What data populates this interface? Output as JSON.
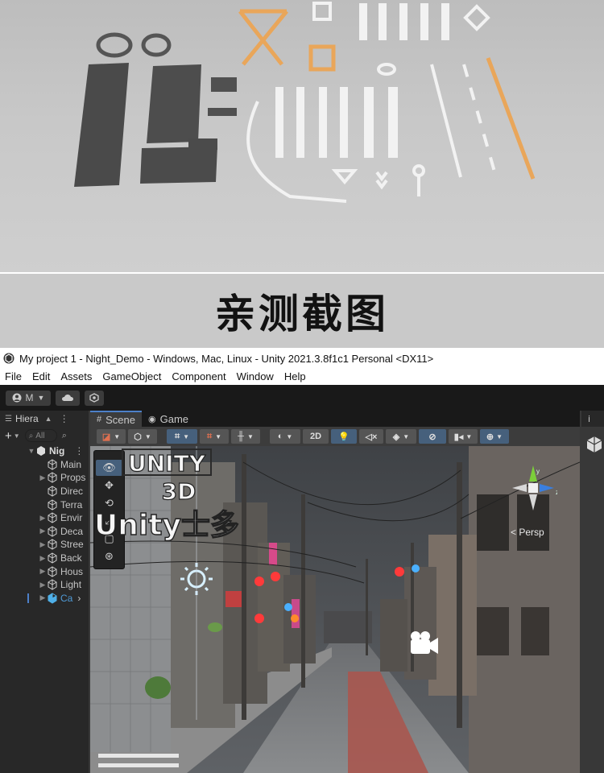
{
  "caption": "亲测截图",
  "window": {
    "title": "My project 1 - Night_Demo - Windows, Mac, Linux - Unity 2021.3.8f1c1 Personal <DX11>"
  },
  "menu": [
    "File",
    "Edit",
    "Assets",
    "GameObject",
    "Component",
    "Window",
    "Help"
  ],
  "toolbar": {
    "account_label": "M"
  },
  "hierarchy": {
    "tab_label": "Hiera",
    "search_placeholder": "All",
    "scene_root": "Nig",
    "items": [
      {
        "label": "Main",
        "expandable": false
      },
      {
        "label": "Props",
        "expandable": true
      },
      {
        "label": "Direc",
        "expandable": false
      },
      {
        "label": "Terra",
        "expandable": false
      },
      {
        "label": "Envir",
        "expandable": true
      },
      {
        "label": "Deca",
        "expandable": true
      },
      {
        "label": "Stree",
        "expandable": true
      },
      {
        "label": "Back",
        "expandable": true
      },
      {
        "label": "Hous",
        "expandable": true
      },
      {
        "label": "Light",
        "expandable": true
      },
      {
        "label": "Ca",
        "expandable": true,
        "selected": true
      }
    ]
  },
  "scene": {
    "tabs": [
      {
        "label": "Scene",
        "icon": "grid-icon",
        "active": true
      },
      {
        "label": "Game",
        "icon": "gamepad-icon",
        "active": false
      }
    ],
    "mode_2d": "2D",
    "persp_label": "< Persp",
    "gizmo_axes": {
      "y": "y",
      "z": "z"
    },
    "tools": [
      "view-eye-icon",
      "move-icon",
      "rotate-icon",
      "scale-icon",
      "rect-icon",
      "transform-icon"
    ]
  },
  "inspector": {
    "tab_label": "i"
  },
  "watermark": {
    "line1": "UNITY",
    "line2": "3D",
    "line3": "Unity士多"
  },
  "colors": {
    "accent": "#4c80c9",
    "selection": "#4f9ad6",
    "orange_marking": "#f0a050"
  }
}
